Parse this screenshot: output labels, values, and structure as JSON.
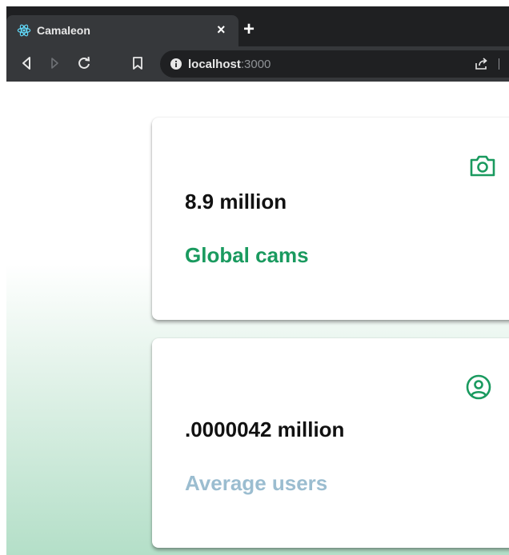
{
  "browser": {
    "tab": {
      "title": "Camaleon",
      "close_glyph": "×"
    },
    "new_tab_glyph": "+",
    "address": {
      "host": "localhost",
      "port": ":3000"
    }
  },
  "cards": [
    {
      "value": "8.9 million",
      "label": "Global cams",
      "icon": "camera-icon",
      "label_color": "#1a9a5f"
    },
    {
      "value": ".0000042 million",
      "label": "Average users",
      "icon": "user-circle-icon",
      "label_color": "#9bbdd0"
    }
  ],
  "colors": {
    "accent_green": "#1a9a5f",
    "muted_blue": "#9bbdd0",
    "browser_dark": "#1f2022",
    "browser_toolbar": "#36383b"
  }
}
